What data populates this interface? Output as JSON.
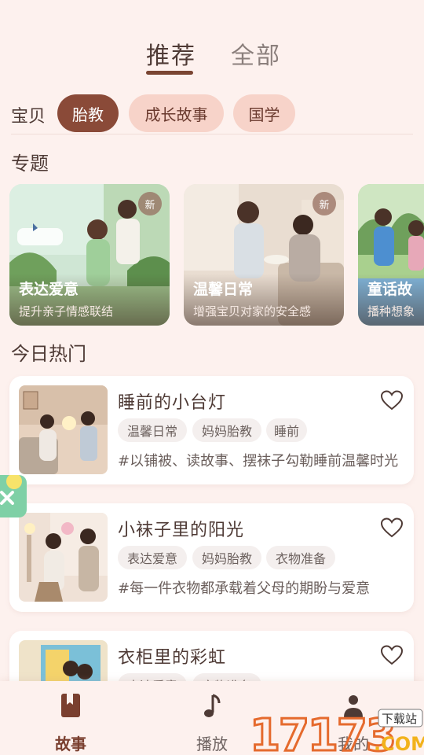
{
  "tabs": [
    {
      "label": "推荐",
      "active": true
    },
    {
      "label": "全部",
      "active": false
    }
  ],
  "category": {
    "label": "宝贝",
    "items": [
      {
        "label": "胎教",
        "selected": true
      },
      {
        "label": "成长故事",
        "selected": false
      },
      {
        "label": "国学",
        "selected": false
      }
    ]
  },
  "topics": {
    "title": "专题",
    "items": [
      {
        "title": "表达爱意",
        "subtitle": "提升亲子情感联结",
        "badge": "新"
      },
      {
        "title": "温馨日常",
        "subtitle": "增强宝贝对家的安全感",
        "badge": "新"
      },
      {
        "title": "童话故",
        "subtitle": "播种想象"
      }
    ]
  },
  "hot": {
    "title": "今日热门",
    "items": [
      {
        "title": "睡前的小台灯",
        "tags": [
          "温馨日常",
          "妈妈胎教",
          "睡前"
        ],
        "desc": "#以铺被、读故事、摆袜子勾勒睡前温馨时光"
      },
      {
        "title": "小袜子里的阳光",
        "tags": [
          "表达爱意",
          "妈妈胎教",
          "衣物准备"
        ],
        "desc": "#每一件衣物都承载着父母的期盼与爱意"
      },
      {
        "title": "衣柜里的彩虹",
        "tags": [
          "表达爱意",
          "衣物准备"
        ],
        "desc": ""
      }
    ]
  },
  "nav": {
    "items": [
      {
        "label": "故事",
        "icon": "book-icon",
        "active": true
      },
      {
        "label": "播放",
        "icon": "music-note-icon",
        "active": false
      },
      {
        "label": "我的",
        "icon": "person-icon",
        "active": false
      }
    ]
  },
  "watermark": {
    "text": "17173",
    "sub": "下载站",
    "suffix": ".COM"
  },
  "colors": {
    "accent": "#8a4a38",
    "pill": "#f7d3c9",
    "background": "#fdf1ee"
  }
}
